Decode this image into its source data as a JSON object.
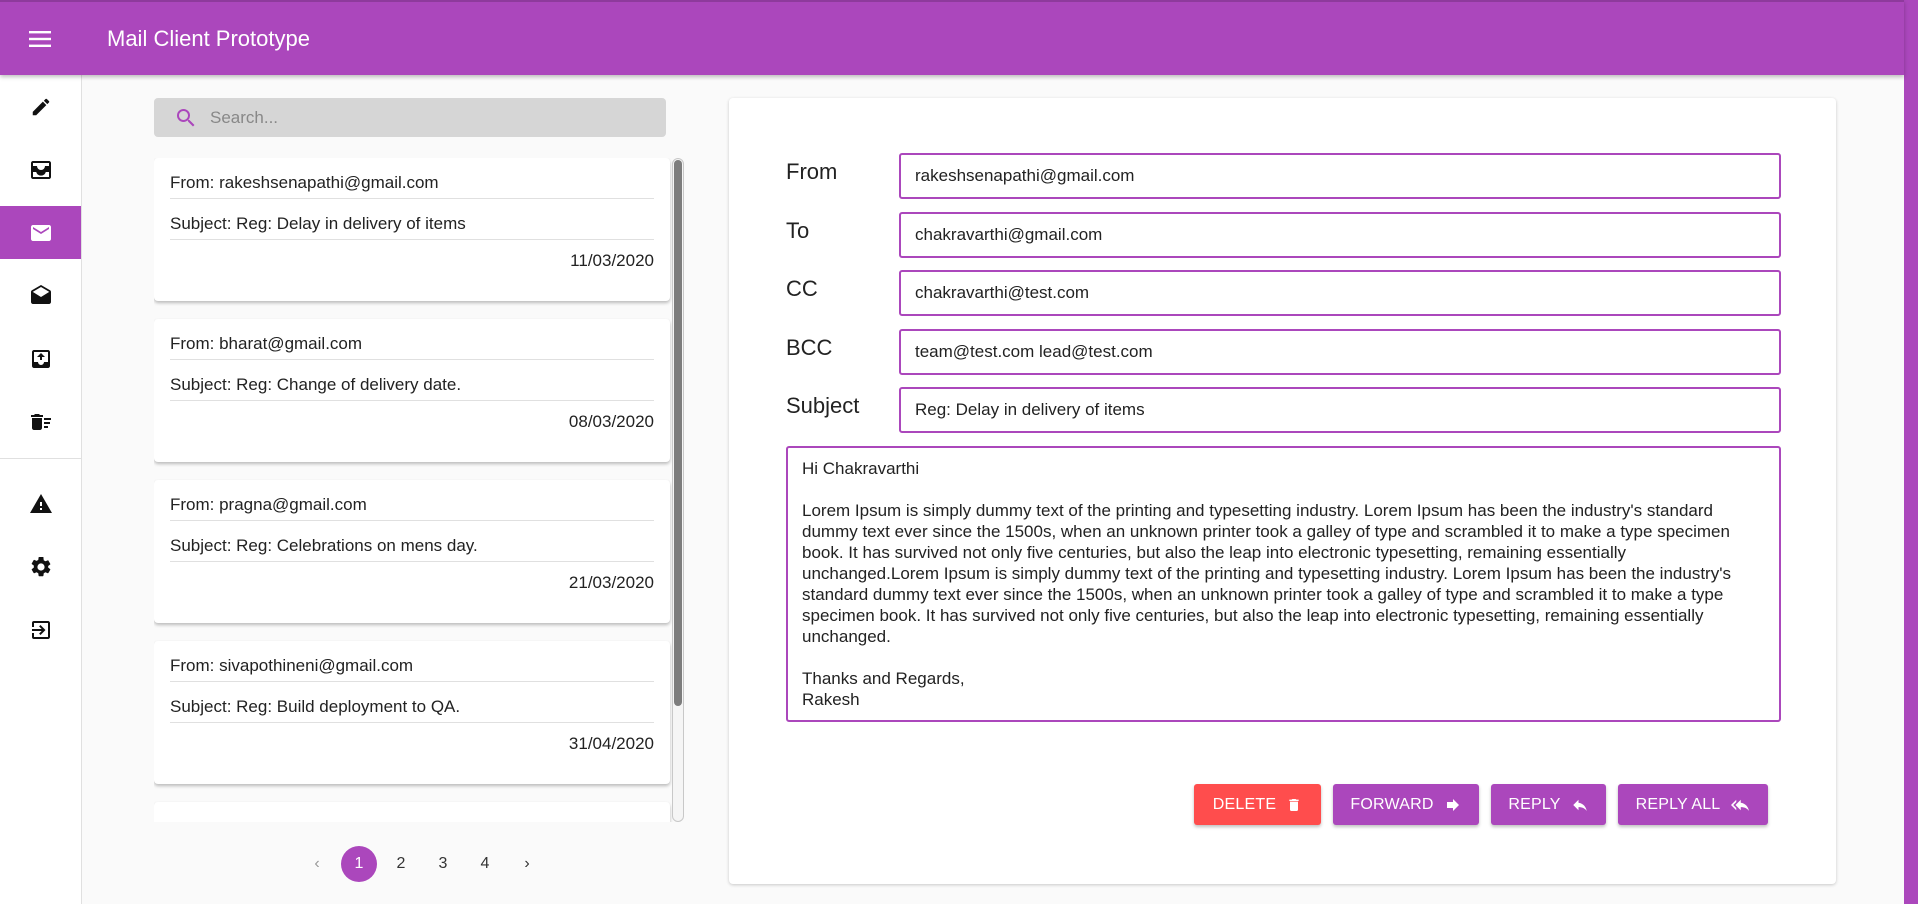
{
  "app": {
    "title": "Mail Client Prototype",
    "accent": "#ab47bc",
    "danger": "#ff4d4d"
  },
  "nav": {
    "items": [
      {
        "name": "compose",
        "icon": "pencil-icon"
      },
      {
        "name": "inbox",
        "icon": "inbox-tray-icon"
      },
      {
        "name": "mail",
        "icon": "envelope-icon",
        "active": true
      },
      {
        "name": "drafts",
        "icon": "open-envelope-icon"
      },
      {
        "name": "sent",
        "icon": "upload-tray-icon"
      },
      {
        "name": "trash",
        "icon": "delete-sweep-icon"
      }
    ],
    "secondary": [
      {
        "name": "spam",
        "icon": "warning-icon"
      },
      {
        "name": "settings",
        "icon": "gear-icon"
      },
      {
        "name": "logout",
        "icon": "exit-icon"
      }
    ]
  },
  "search": {
    "placeholder": "Search..."
  },
  "mails": [
    {
      "from": "From: rakeshsenapathi@gmail.com",
      "subject": "Subject: Reg: Delay in delivery of items",
      "date": "11/03/2020"
    },
    {
      "from": "From: bharat@gmail.com",
      "subject": "Subject: Reg: Change of delivery date.",
      "date": "08/03/2020"
    },
    {
      "from": "From: pragna@gmail.com",
      "subject": "Subject: Reg: Celebrations on mens day.",
      "date": "21/03/2020"
    },
    {
      "from": "From: sivapothineni@gmail.com",
      "subject": "Subject: Reg: Build deployment to QA.",
      "date": "31/04/2020"
    }
  ],
  "pagination": {
    "pages": [
      "1",
      "2",
      "3",
      "4"
    ],
    "current": "1",
    "prev": "‹",
    "next": "›"
  },
  "detail": {
    "from_label": "From",
    "from": "rakeshsenapathi@gmail.com",
    "to_label": "To",
    "to": "chakravarthi@gmail.com",
    "cc_label": "CC",
    "cc": "chakravarthi@test.com",
    "bcc_label": "BCC",
    "bcc": "team@test.com lead@test.com",
    "subject_label": "Subject",
    "subject": "Reg: Delay in delivery of items",
    "body": "Hi Chakravarthi\n\nLorem Ipsum is simply dummy text of the printing and typesetting industry. Lorem Ipsum has been the industry's standard dummy text ever since the 1500s, when an unknown printer took a galley of type and scrambled it to make a type specimen book. It has survived not only five centuries, but also the leap into electronic typesetting, remaining essentially unchanged.Lorem Ipsum is simply dummy text of the printing and typesetting industry. Lorem Ipsum has been the industry's standard dummy text ever since the 1500s, when an unknown printer took a galley of type and scrambled it to make a type specimen book. It has survived not only five centuries, but also the leap into electronic typesetting, remaining essentially unchanged.\n\nThanks and Regards,\nRakesh"
  },
  "actions": {
    "delete": "DELETE",
    "forward": "FORWARD",
    "reply": "REPLY",
    "reply_all": "REPLY ALL"
  }
}
